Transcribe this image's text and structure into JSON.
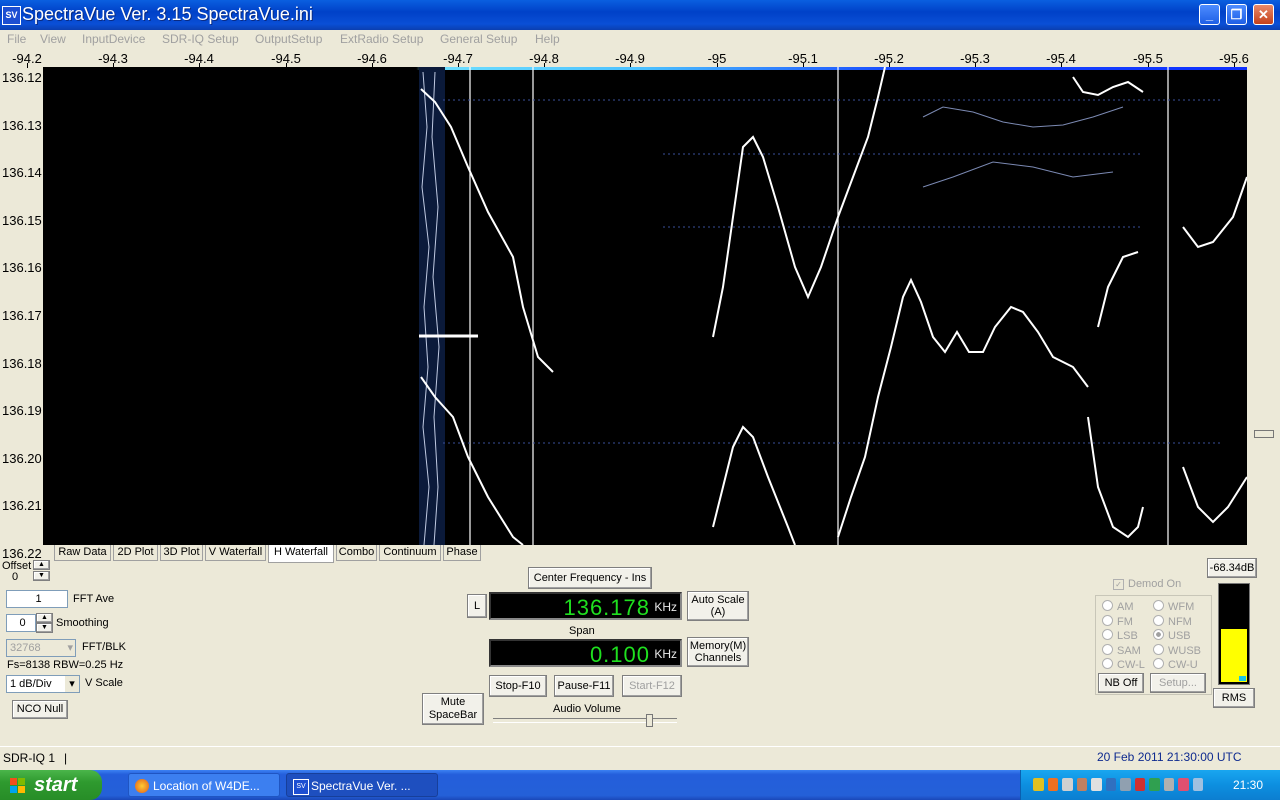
{
  "window": {
    "title": "SpectraVue Ver. 3.15  SpectraVue.ini",
    "icon_text": "SV"
  },
  "menu": [
    "File",
    "View",
    "InputDevice",
    "SDR-IQ Setup",
    "OutputSetup",
    "ExtRadio Setup",
    "General Setup",
    "Help"
  ],
  "freq_axis": [
    "-94.2",
    "-94.3",
    "-94.4",
    "-94.5",
    "-94.6",
    "-94.7",
    "-94.8",
    "-94.9",
    "-95",
    "-95.1",
    "-95.2",
    "-95.3",
    "-95.4",
    "-95.5",
    "-95.6"
  ],
  "time_axis": [
    "136.12",
    "136.13",
    "136.14",
    "136.15",
    "136.16",
    "136.17",
    "136.18",
    "136.19",
    "136.20",
    "136.21",
    "136.22"
  ],
  "tabs": [
    {
      "label": "Raw Data",
      "active": false
    },
    {
      "label": "2D Plot",
      "active": false
    },
    {
      "label": "3D Plot",
      "active": false
    },
    {
      "label": "V Waterfall",
      "active": false
    },
    {
      "label": "H Waterfall",
      "active": true
    },
    {
      "label": "Combo",
      "active": false
    },
    {
      "label": "Continuum",
      "active": false
    },
    {
      "label": "Phase",
      "active": false
    }
  ],
  "left_panel": {
    "offset_label": "Offset",
    "offset_value": "0",
    "fft_ave_value": "1",
    "fft_ave_label": "FFT Ave",
    "smoothing_value": "0",
    "smoothing_label": "Smoothing",
    "fft_blk_value": "32768",
    "fft_blk_label": "FFT/BLK",
    "fs_info": "Fs=8138 RBW=0.25 Hz",
    "vscale_value": "1 dB/Div",
    "vscale_label": "V Scale",
    "nco_button": "NCO Null"
  },
  "center": {
    "center_freq_button": "Center Frequency - Ins",
    "l_button": "L",
    "freq_value": "136.178",
    "freq_unit": "KHz",
    "auto_scale_button": [
      "Auto Scale",
      "(A)"
    ],
    "span_label": "Span",
    "span_value": "0.100",
    "span_unit": "KHz",
    "memory_button": [
      "Memory(M)",
      "Channels"
    ],
    "mute_button": [
      "Mute",
      "SpaceBar"
    ],
    "stop_button": "Stop-F10",
    "pause_button": "Pause-F11",
    "start_button": "Start-F12",
    "audio_volume_label": "Audio Volume",
    "audio_volume_level": 0.85
  },
  "demod": {
    "level_readout": "-68.34dB",
    "demod_on_label": "Demod On",
    "modes_left": [
      {
        "label": "AM",
        "checked": false
      },
      {
        "label": "FM",
        "checked": false
      },
      {
        "label": "LSB",
        "checked": false
      },
      {
        "label": "SAM",
        "checked": false
      },
      {
        "label": "CW-L",
        "checked": false
      }
    ],
    "modes_right": [
      {
        "label": "WFM",
        "checked": false
      },
      {
        "label": "NFM",
        "checked": false
      },
      {
        "label": "USB",
        "checked": true
      },
      {
        "label": "WUSB",
        "checked": false
      },
      {
        "label": "CW-U",
        "checked": false
      }
    ],
    "nb_button": "NB Off",
    "setup_button": "Setup...",
    "rms_button": "RMS",
    "meter_fill": 0.55
  },
  "status": {
    "device": "SDR-IQ 1",
    "separator": "|",
    "datetime": "20 Feb 2011   21:30:00 UTC"
  },
  "taskbar": {
    "start_label": "start",
    "tasks": [
      "Location of W4DE...",
      "SpectraVue Ver. ..."
    ],
    "clock": "21:30"
  }
}
